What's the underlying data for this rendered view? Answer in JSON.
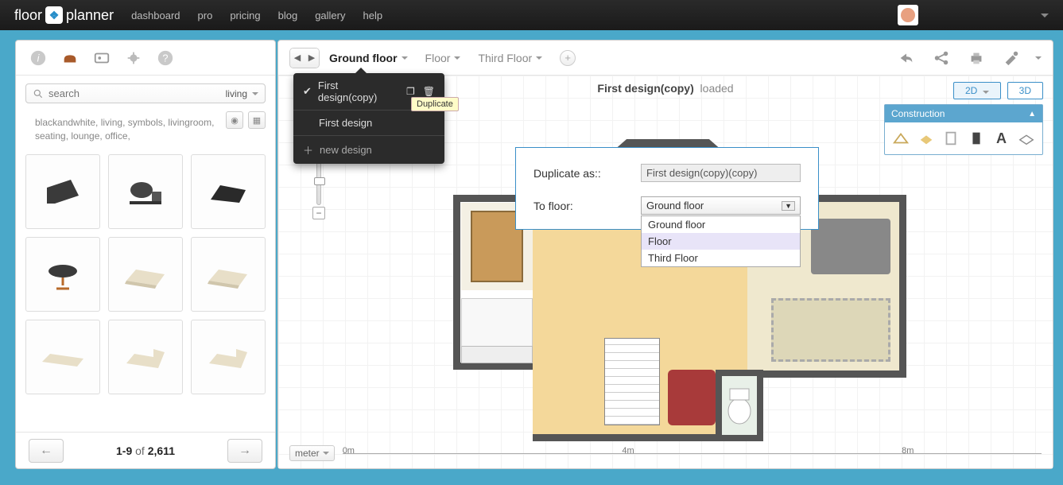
{
  "topnav": {
    "logo_left": "floor",
    "logo_right": "planner",
    "links": [
      "dashboard",
      "pro",
      "pricing",
      "blog",
      "gallery",
      "help"
    ]
  },
  "sidebar": {
    "search_placeholder": "search",
    "filter": "living",
    "tags": "blackandwhite, living, symbols, livingroom, seating, lounge, office,",
    "pager_range": "1-9",
    "pager_of": "of",
    "pager_total": "2,611"
  },
  "floor_tabs": {
    "active": "Ground floor",
    "others": [
      "Floor",
      "Third Floor"
    ]
  },
  "design_menu": {
    "items": [
      "First design(copy)",
      "First design",
      "new design"
    ],
    "tooltip": "Duplicate"
  },
  "canvas": {
    "title_b": "First design(copy)",
    "title_status": "loaded"
  },
  "viewswitch": {
    "v2d": "2D",
    "v3d": "3D"
  },
  "construction": {
    "title": "Construction"
  },
  "modal": {
    "label1": "Duplicate as::",
    "value1": "First design(copy)(copy)",
    "label2": "To floor:",
    "selected": "Ground floor",
    "options": [
      "Ground floor",
      "Floor",
      "Third Floor"
    ],
    "hover_index": 1
  },
  "ruler": {
    "unit": "meter",
    "ticks": [
      "0m",
      "4m",
      "8m"
    ]
  }
}
